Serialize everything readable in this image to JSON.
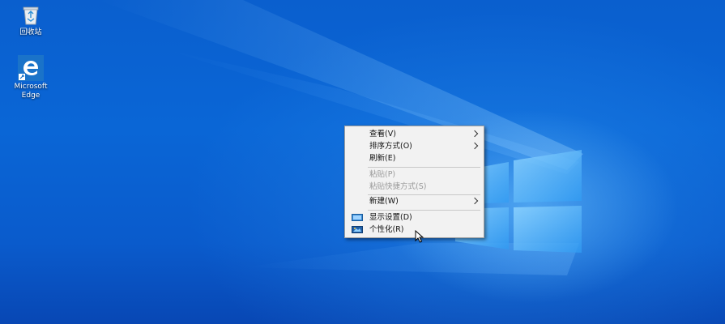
{
  "desktop": {
    "icons": [
      {
        "label": "回收站",
        "icon": "recycle-bin-icon"
      },
      {
        "label": "Microsoft\nEdge",
        "icon": "edge-icon"
      }
    ]
  },
  "context_menu": {
    "items": [
      {
        "label": "查看(V)",
        "submenu": true,
        "enabled": true
      },
      {
        "label": "排序方式(O)",
        "submenu": true,
        "enabled": true
      },
      {
        "label": "刷新(E)",
        "submenu": false,
        "enabled": true
      },
      {
        "label": "粘贴(P)",
        "submenu": false,
        "enabled": false
      },
      {
        "label": "粘贴快捷方式(S)",
        "submenu": false,
        "enabled": false
      },
      {
        "label": "新建(W)",
        "submenu": true,
        "enabled": true
      },
      {
        "label": "显示设置(D)",
        "submenu": false,
        "enabled": true,
        "icon": "display-settings-icon"
      },
      {
        "label": "个性化(R)",
        "submenu": false,
        "enabled": true,
        "icon": "personalize-icon"
      }
    ]
  },
  "colors": {
    "desktop_blue": "#0a5fce",
    "menu_background": "#f2f2f2",
    "disabled_text": "#9a9a9a"
  }
}
